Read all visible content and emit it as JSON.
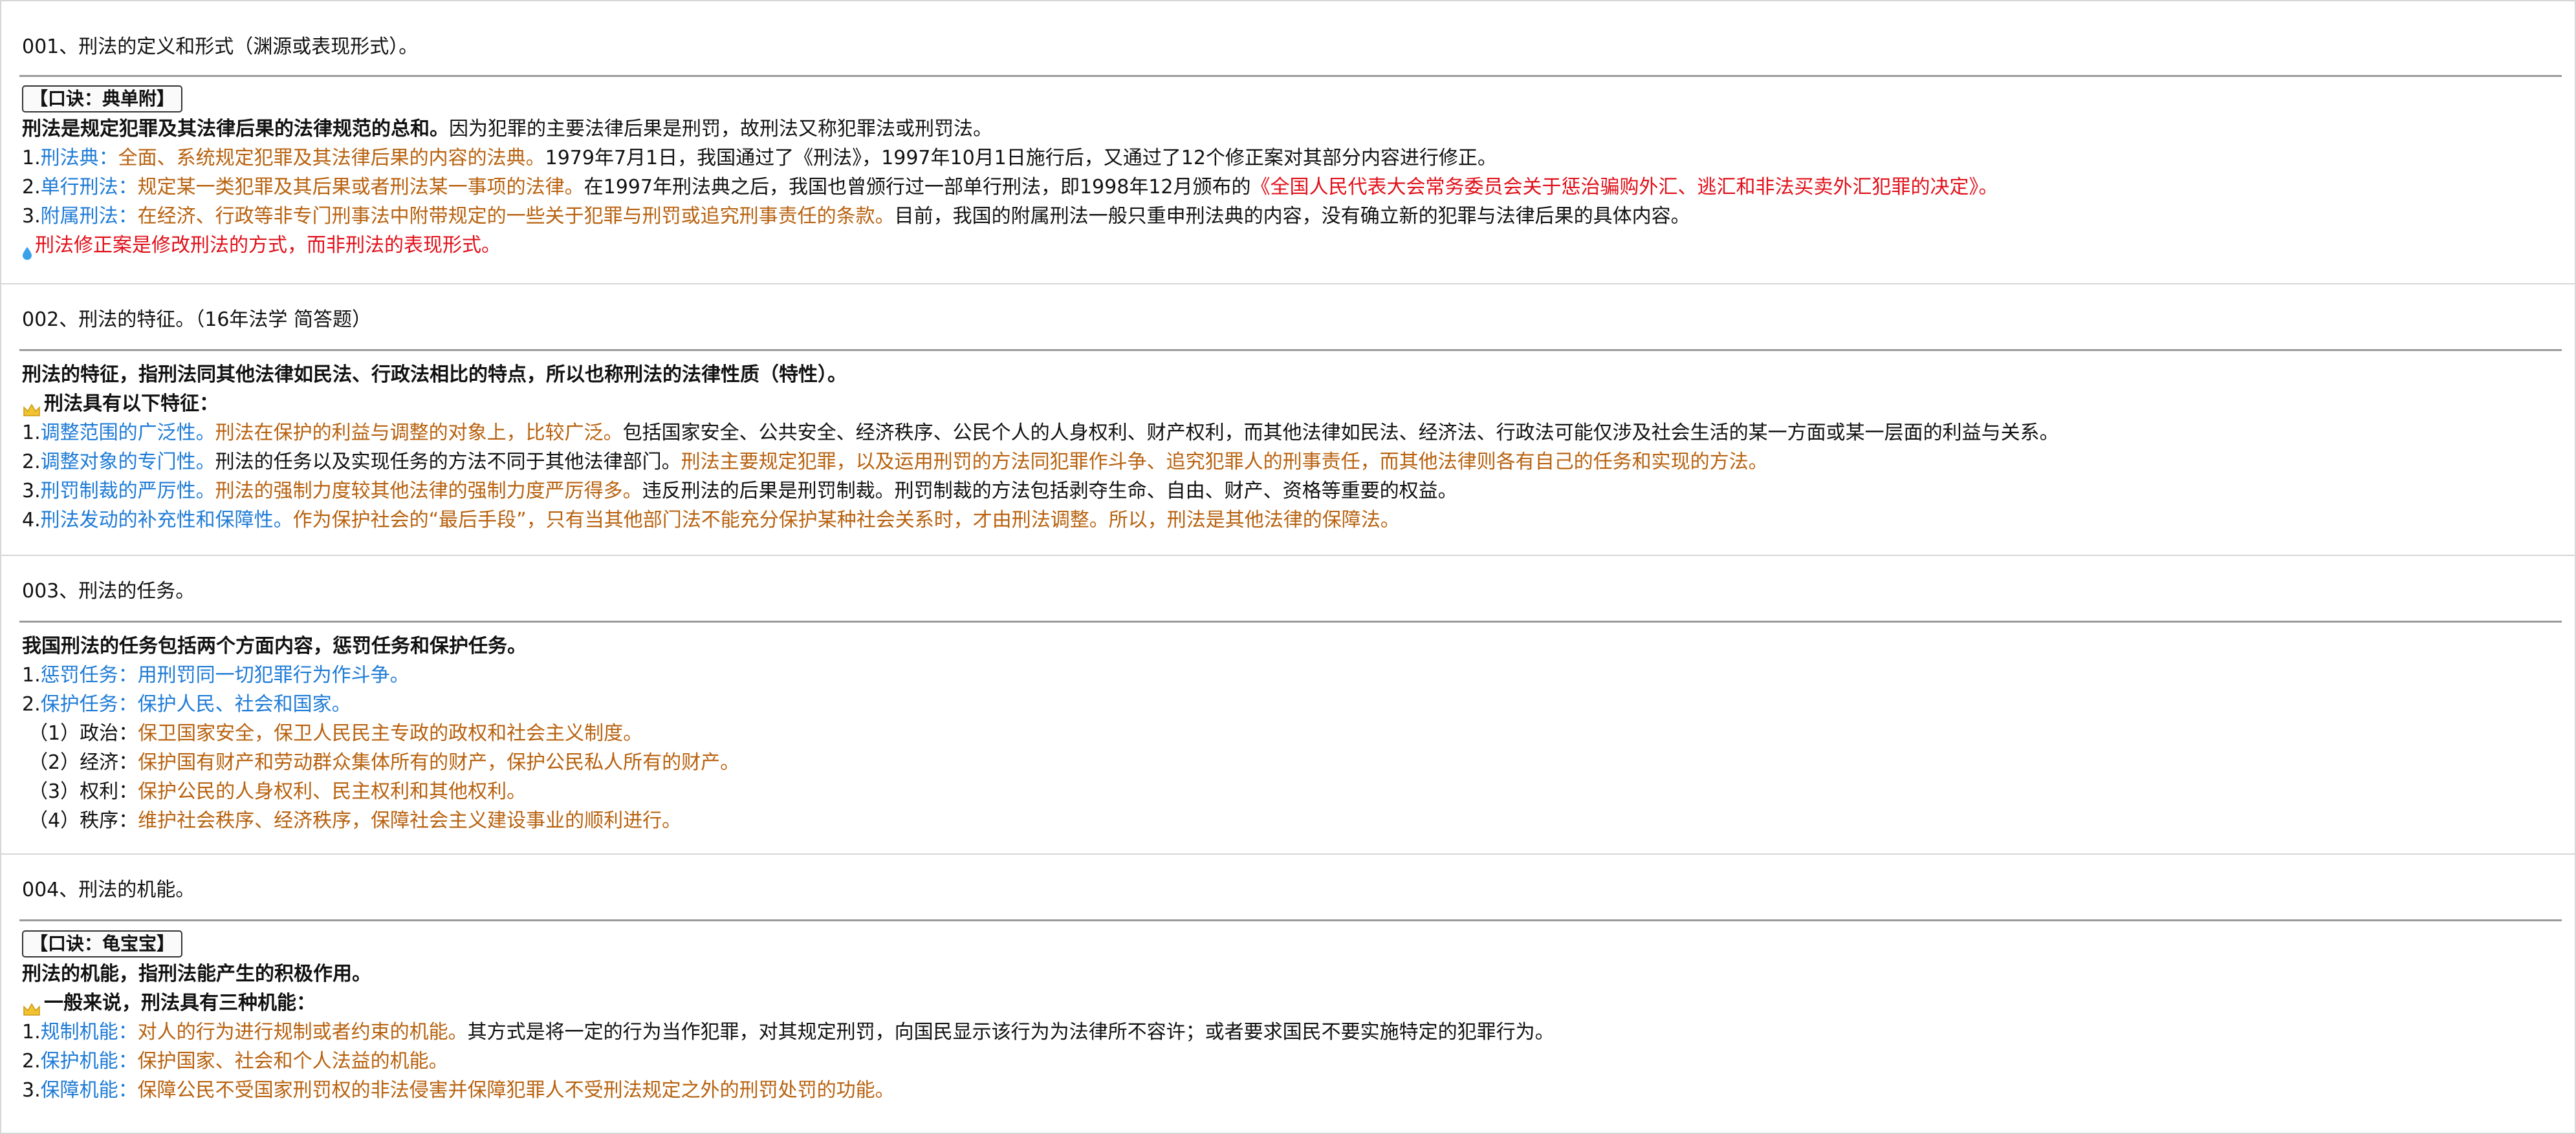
{
  "colors": {
    "keyword": "#1e7bd6",
    "explanation": "#b8620f",
    "highlight": "#e0101a",
    "divider": "#9a9a9a"
  },
  "sections": [
    {
      "question": "001、刑法的定义和形式（渊源或表现形式）。",
      "mnemonic": "【口诀：典单附】",
      "definition_bold": "刑法是规定犯罪及其法律后果的法律规范的总和。",
      "definition_rest": "因为犯罪的主要法律后果是刑罚，故刑法又称犯罪法或刑罚法。",
      "items": [
        {
          "num": "1. ",
          "key": "刑法典：",
          "exp": "全面、系统规定犯罪及其法律后果的内容的法典。",
          "rest": "1979年7月1日，我国通过了《刑法》，1997年10月1日施行后，又通过了12个修正案对其部分内容进行修正。"
        },
        {
          "num": "2. ",
          "key": "单行刑法：",
          "exp": "规定某一类犯罪及其后果或者刑法某一事项的法律。",
          "rest": "在1997年刑法典之后，我国也曾颁行过一部单行刑法，即1998年12月颁布的",
          "red": "《全国人民代表大会常务委员会关于惩治骗购外汇、逃汇和非法买卖外汇犯罪的决定》。"
        },
        {
          "num": "3. ",
          "key": "附属刑法：",
          "exp": "在经济、行政等非专门刑事法中附带规定的一些关于犯罪与刑罚或追究刑事责任的条款。",
          "rest": "目前，我国的附属刑法一般只重申刑法典的内容，没有确立新的犯罪与法律后果的具体内容。"
        }
      ],
      "note_icon": "water-drop-icon",
      "note": "刑法修正案是修改刑法的方式，而非刑法的表现形式。"
    },
    {
      "question": "002、刑法的特征。（16年法学 简答题）",
      "definition_bold": "刑法的特征，指刑法同其他法律如民法、行政法相比的特点，所以也称刑法的法律性质（特性）。",
      "lead_icon": "crown-icon",
      "lead": "刑法具有以下特征：",
      "items": [
        {
          "num": "1. ",
          "key": "调整范围的广泛性。",
          "exp": "刑法在保护的利益与调整的对象上，比较广泛。",
          "rest": "包括国家安全、公共安全、经济秩序、公民个人的人身权利、财产权利，而其他法律如民法、经济法、行政法可能仅涉及社会生活的某一方面或某一层面的利益与关系。"
        },
        {
          "num": "2. ",
          "key": "调整对象的专门性。",
          "rest": "刑法的任务以及实现任务的方法不同于其他法律部门。",
          "exp2": "刑法主要规定犯罪，以及运用刑罚的方法同犯罪作斗争、追究犯罪人的刑事责任，而其他法律则各有自己的任务和实现的方法。"
        },
        {
          "num": "3. ",
          "key": "刑罚制裁的严厉性。",
          "exp": "刑法的强制力度较其他法律的强制力度严厉得多。",
          "rest": "违反刑法的后果是刑罚制裁。刑罚制裁的方法包括剥夺生命、自由、财产、资格等重要的权益。"
        },
        {
          "num": "4. ",
          "key": "刑法发动的补充性和保障性。",
          "exp": "作为保护社会的“最后手段”，只有当其他部门法不能充分保护某种社会关系时，才由刑法调整。所以，刑法是其他法律的保障法。"
        }
      ]
    },
    {
      "question": "003、刑法的任务。",
      "definition_bold": "我国刑法的任务包括两个方面内容，惩罚任务和保护任务。",
      "items": [
        {
          "num": "1. ",
          "key": "惩罚任务：用刑罚同一切犯罪行为作斗争。"
        },
        {
          "num": "2. ",
          "key": "保护任务：保护人民、社会和国家。"
        }
      ],
      "subitems": [
        {
          "label": "（1）政治：",
          "text": "保卫国家安全，保卫人民民主专政的政权和社会主义制度。"
        },
        {
          "label": "（2）经济：",
          "text": "保护国有财产和劳动群众集体所有的财产，保护公民私人所有的财产。"
        },
        {
          "label": "（3）权利：",
          "text": "保护公民的人身权利、民主权利和其他权利。"
        },
        {
          "label": "（4）秩序：",
          "text": "维护社会秩序、经济秩序，保障社会主义建设事业的顺利进行。"
        }
      ]
    },
    {
      "question": "004、刑法的机能。",
      "mnemonic": "【口诀：龟宝宝】",
      "definition_bold": "刑法的机能，指刑法能产生的积极作用。",
      "lead_icon": "crown-icon",
      "lead": "一般来说，刑法具有三种机能：",
      "items": [
        {
          "num": "1. ",
          "key": "规制机能：",
          "exp": "对人的行为进行规制或者约束的机能。",
          "rest": "其方式是将一定的行为当作犯罪，对其规定刑罚，向国民显示该行为为法律所不容许；或者要求国民不要实施特定的犯罪行为。"
        },
        {
          "num": "2. ",
          "key": "保护机能：",
          "exp": "保护国家、社会和个人法益的机能。"
        },
        {
          "num": "3. ",
          "key": "保障机能：",
          "exp": "保障公民不受国家刑罚权的非法侵害并保障犯罪人不受刑法规定之外的刑罚处罚的功能。"
        }
      ]
    }
  ]
}
